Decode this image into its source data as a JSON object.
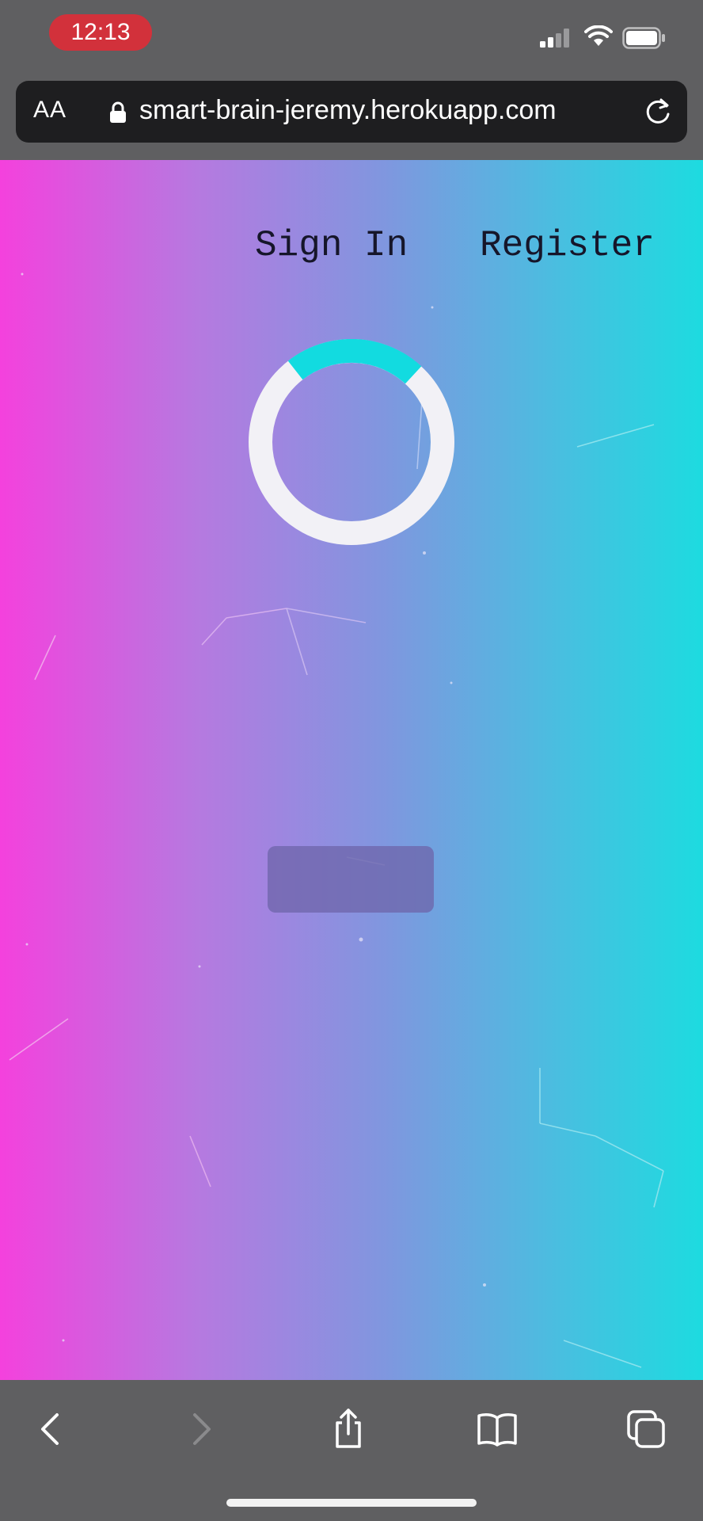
{
  "status_bar": {
    "time": "12:13"
  },
  "browser": {
    "text_size_label": "AA",
    "url": "smart-brain-jeremy.herokuapp.com"
  },
  "navigation": {
    "sign_in": "Sign In",
    "register": "Register"
  },
  "loader": {
    "accent_color": "#12dbe0",
    "track_color": "#f2f1f6"
  },
  "toolbar": {
    "icons": [
      "back-icon",
      "forward-icon",
      "share-icon",
      "bookmarks-icon",
      "tabs-icon"
    ]
  },
  "colors": {
    "gradient_start": "#f441dd",
    "gradient_end": "#1ddbe0",
    "chrome": "#5f5f61"
  }
}
